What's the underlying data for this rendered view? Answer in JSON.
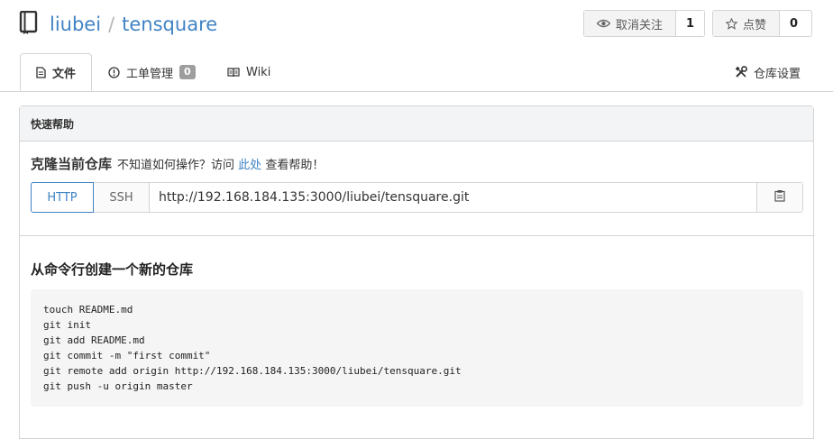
{
  "repo": {
    "owner": "liubei",
    "separator": "/",
    "name": "tensquare"
  },
  "actions": {
    "watch": {
      "label": "取消关注",
      "count": "1"
    },
    "star": {
      "label": "点赞",
      "count": "0"
    }
  },
  "tabs": [
    {
      "label": "文件",
      "icon": "file-text-icon"
    },
    {
      "label": "工单管理",
      "icon": "issue-opened-icon",
      "badge": "0"
    },
    {
      "label": "Wiki",
      "icon": "book-icon"
    },
    {
      "label": "仓库设置",
      "icon": "tools-icon"
    }
  ],
  "quick_help": {
    "title": "快速帮助",
    "clone_title": "克隆当前仓库",
    "clone_hint": "不知道如何操作？访问",
    "clone_link": "此处",
    "clone_suffix": "查看帮助！",
    "protocols": [
      "HTTP",
      "SSH"
    ],
    "clone_url": "http://192.168.184.135:3000/liubei/tensquare.git"
  },
  "new_repo": {
    "title": "从命令行创建一个新的仓库",
    "commands": [
      "touch README.md",
      "git init",
      "git add README.md",
      "git commit -m \"first commit\"",
      "git remote add origin http://192.168.184.135:3000/liubei/tensquare.git",
      "git push -u origin master"
    ]
  },
  "colors": {
    "link": "#4183c4",
    "border": "#d4d4d5",
    "header_bg": "#f3f4f5",
    "code_bg": "#f5f5f5"
  }
}
